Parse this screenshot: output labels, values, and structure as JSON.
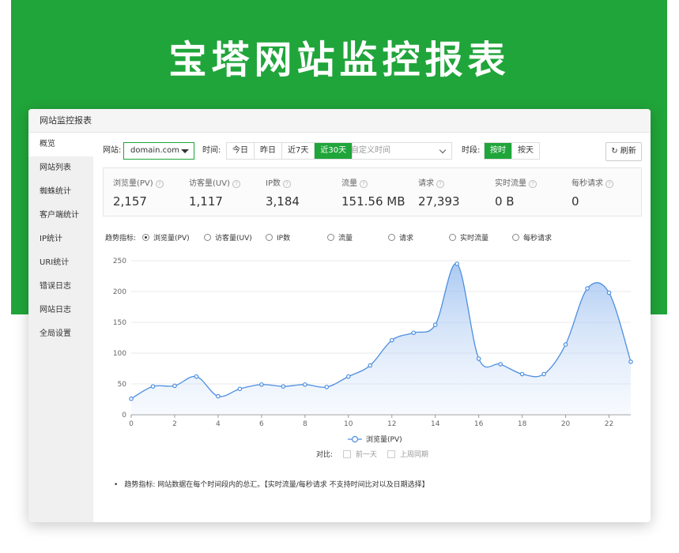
{
  "hero": {
    "title": "宝塔网站监控报表"
  },
  "panel": {
    "title": "网站监控报表"
  },
  "sidebar": {
    "items": [
      {
        "label": "概览",
        "active": true
      },
      {
        "label": "网站列表"
      },
      {
        "label": "蜘蛛统计"
      },
      {
        "label": "客户端统计"
      },
      {
        "label": "IP统计"
      },
      {
        "label": "URI统计"
      },
      {
        "label": "错误日志"
      },
      {
        "label": "网站日志"
      },
      {
        "label": "全局设置"
      }
    ]
  },
  "toolbar": {
    "site_label": "网站:",
    "site_value": "domain.com",
    "time_label": "时间:",
    "time_buttons": [
      "今日",
      "昨日",
      "近7天",
      "近30天"
    ],
    "time_selected": "近30天",
    "custom_time_placeholder": "自定义时间",
    "period_label": "时段:",
    "period_buttons": [
      "按时",
      "按天"
    ],
    "period_selected": "按时",
    "refresh_label": "刷新"
  },
  "stats": [
    {
      "label": "浏览量(PV)",
      "value": "2,157"
    },
    {
      "label": "访客量(UV)",
      "value": "1,117"
    },
    {
      "label": "IP数",
      "value": "3,184"
    },
    {
      "label": "流量",
      "value": "151.56 MB"
    },
    {
      "label": "请求",
      "value": "27,393"
    },
    {
      "label": "实时流量",
      "value": "0 B"
    },
    {
      "label": "每秒请求",
      "value": "0"
    }
  ],
  "trend": {
    "label": "趋势指标:",
    "options": [
      "浏览量(PV)",
      "访客量(UV)",
      "IP数",
      "流量",
      "请求",
      "实时流量",
      "每秒请求"
    ],
    "selected": "浏览量(PV)"
  },
  "chart_data": {
    "type": "area",
    "x": [
      0,
      1,
      2,
      3,
      4,
      5,
      6,
      7,
      8,
      9,
      10,
      11,
      12,
      13,
      14,
      15,
      16,
      17,
      18,
      19,
      20,
      21,
      22,
      23
    ],
    "series": [
      {
        "name": "浏览量(PV)",
        "values": [
          26,
          46,
          47,
          62,
          30,
          42,
          49,
          46,
          49,
          45,
          62,
          80,
          121,
          133,
          146,
          245,
          91,
          82,
          66,
          66,
          114,
          205,
          198,
          86
        ]
      }
    ],
    "ylim": [
      0,
      250
    ],
    "yticks": [
      "0",
      "50",
      "100",
      "150",
      "200",
      "250"
    ],
    "xticks": [
      "0",
      "2",
      "4",
      "6",
      "8",
      "10",
      "12",
      "14",
      "16",
      "18",
      "20",
      "22"
    ],
    "grid": true,
    "legend": "bottom",
    "line_color": "#4d8fe0"
  },
  "compare": {
    "label": "对比:",
    "options": [
      "前一天",
      "上周同期"
    ]
  },
  "note": "趋势指标: 网站数据在每个时间段内的总汇。【实时流量/每秒请求 不支持时间比对以及日期选择】"
}
